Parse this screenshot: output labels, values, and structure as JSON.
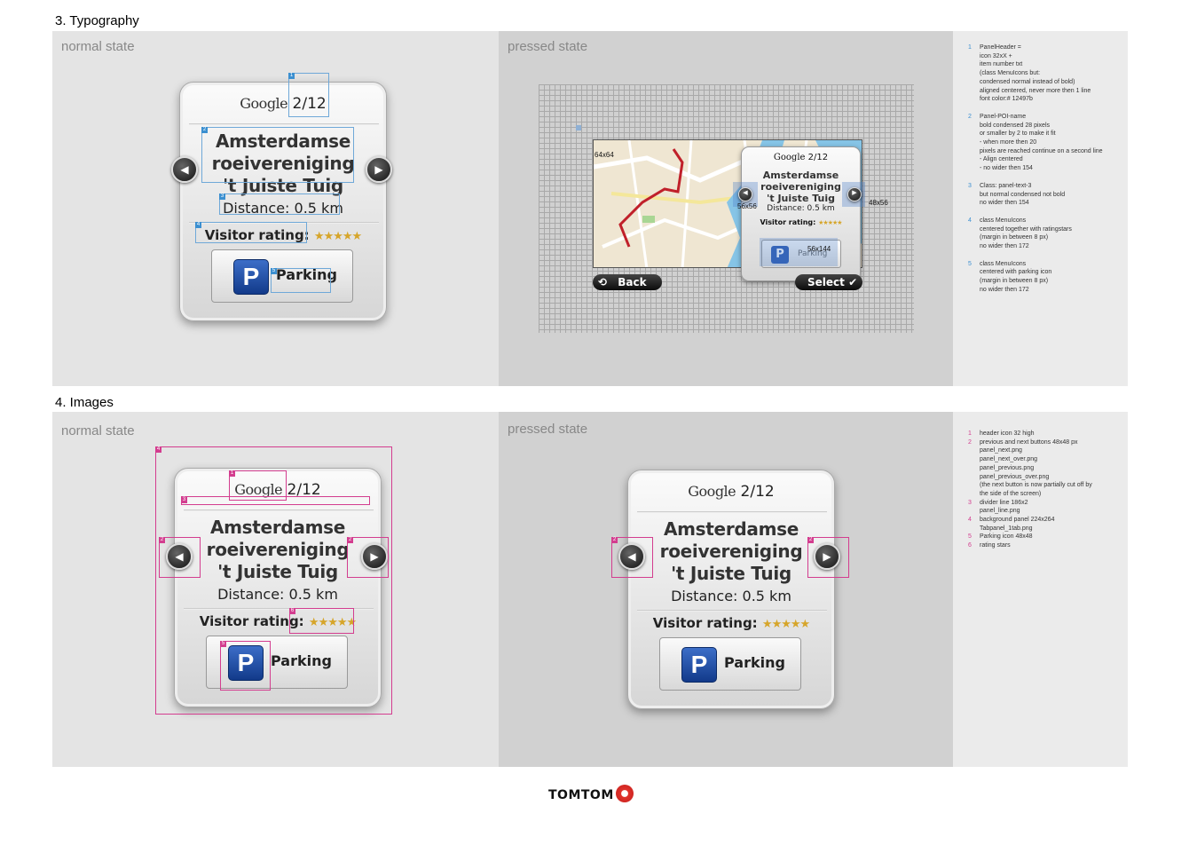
{
  "section3": {
    "title": "3. Typography",
    "normal": "normal state",
    "pressed": "pressed state"
  },
  "section4": {
    "title": "4. Images",
    "normal": "normal state",
    "pressed": "pressed state"
  },
  "panel": {
    "google": "Google",
    "count": "2/12",
    "name_l1": "Amsterdamse",
    "name_l2": "roeivereniging",
    "name_l3": "'t Juiste Tuig",
    "distance": "Distance: 0.5 km",
    "rating_label": "Visitor rating:",
    "stars": "★★★★★",
    "parking": "Parking",
    "p": "P"
  },
  "screen": {
    "back": "Back",
    "select": "Select",
    "dim_icon": "64x64",
    "dim_prev": "56x56",
    "dim_next": "48x56",
    "dim_park": "56x144"
  },
  "typo_notes": [
    {
      "n": "1",
      "t": "PanelHeader =\nicon 32xX +\nitem number txt\n(class MenuIcons but:\ncondensed normal instead of bold)\naligned centered, never more then 1 line\nfont color:# 12497b"
    },
    {
      "n": "2",
      "t": "Panel-POI-name\nbold condensed 28 pixels\nor smaller by 2 to make it fit\n- when more then 20\npixels are reached continue on a second line\n- Align centered\n- no wider then 154"
    },
    {
      "n": "3",
      "t": "Class: panel-text-3\nbut normal condensed not bold\nno wider then 154"
    },
    {
      "n": "4",
      "t": "class MenuIcons\ncentered together with ratingstars\n(margin in between 8 px)\nno wider then 172"
    },
    {
      "n": "5",
      "t": "class MenuIcons\ncentered with parking icon\n(margin in between 8 px)\nno wider then 172"
    }
  ],
  "image_notes": [
    {
      "n": "1",
      "t": "header icon 32 high"
    },
    {
      "n": "2",
      "t": "previous and next buttons 48x48 px\npanel_next.png\npanel_next_over.png\npanel_previous.png\npanel_previous_over.png\n(the next button is now partially cut off by\nthe side of the screen)"
    },
    {
      "n": "3",
      "t": "divider line 186x2\npanel_line.png"
    },
    {
      "n": "4",
      "t": "background panel 224x264\nTabpanel_1tab.png"
    },
    {
      "n": "5",
      "t": "Parking icon 48x48"
    },
    {
      "n": "6",
      "t": "rating stars"
    }
  ],
  "footer": {
    "brand": "TOMTOM"
  }
}
